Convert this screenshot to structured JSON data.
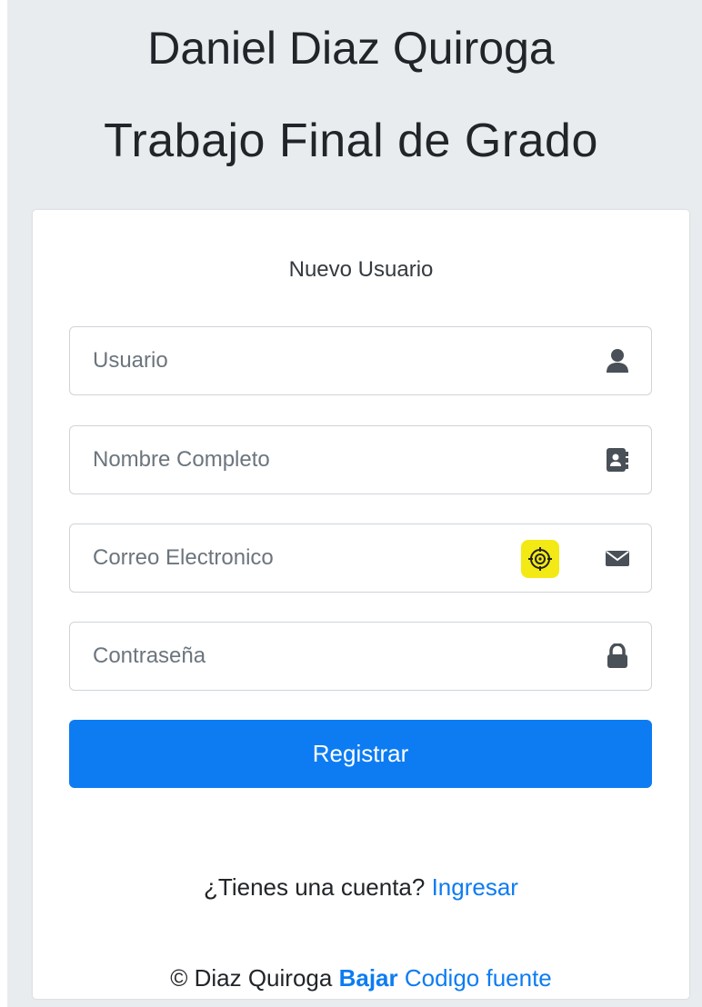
{
  "header": {
    "name": "Daniel Diaz Quiroga",
    "subtitle": "Trabajo Final de Grado"
  },
  "form": {
    "title": "Nuevo Usuario",
    "fields": [
      {
        "placeholder": "Usuario",
        "icon": "user-icon"
      },
      {
        "placeholder": "Nombre Completo",
        "icon": "address-card-icon"
      },
      {
        "placeholder": "Correo Electronico",
        "icon": "envelope-icon"
      },
      {
        "placeholder": "Contraseña",
        "icon": "lock-icon"
      }
    ],
    "submit_label": "Registrar"
  },
  "login_prompt": {
    "text": "¿Tienes una cuenta?",
    "link": "Ingresar"
  },
  "footer": {
    "copyright": "© Diaz Quiroga",
    "download": "Bajar",
    "source": "Codigo fuente"
  },
  "colors": {
    "primary": "#0d7cf2",
    "background": "#e9ecef",
    "badge": "#f3e915"
  }
}
